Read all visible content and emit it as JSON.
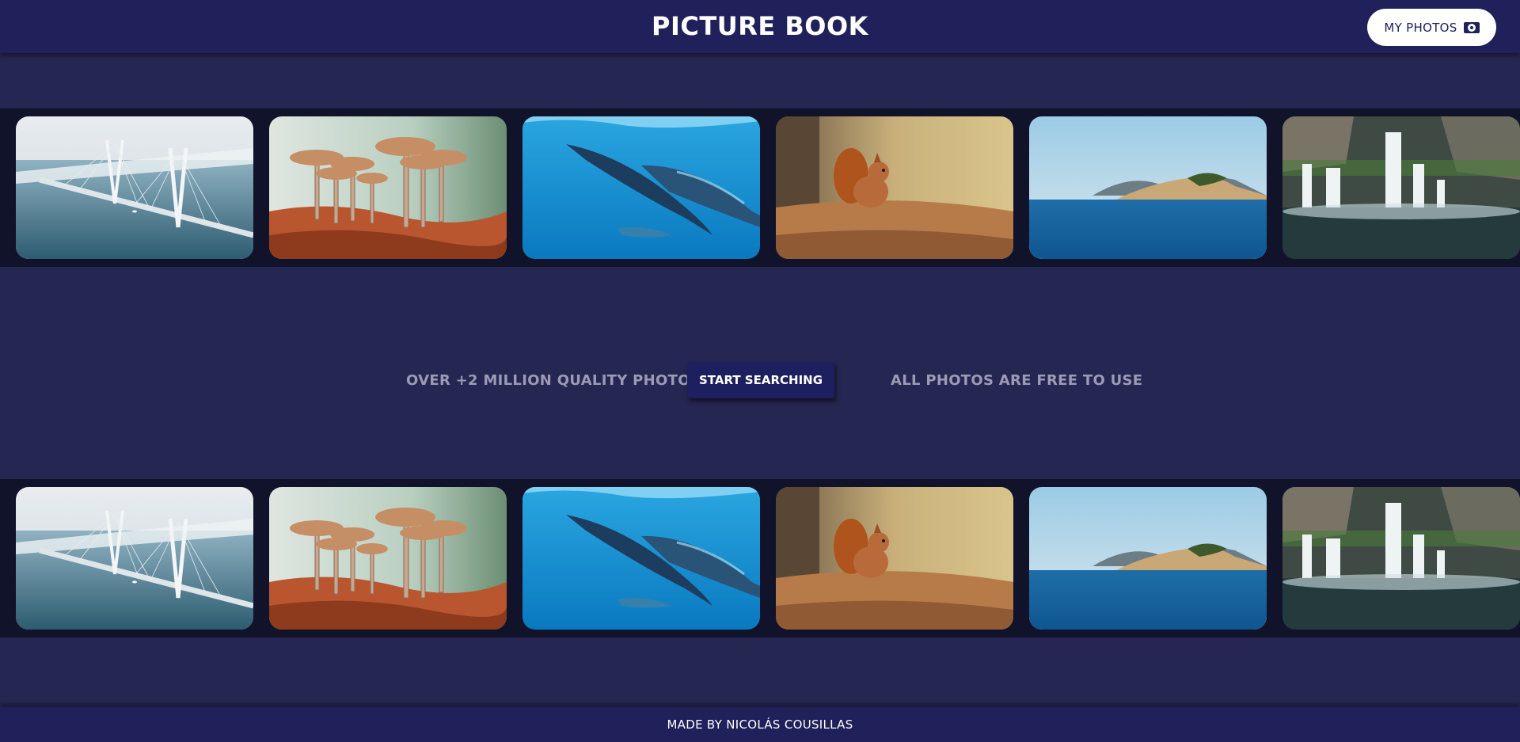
{
  "header": {
    "title": "PICTURE BOOK",
    "my_photos_label": "MY PHOTOS",
    "my_photos_icon": "camera-icon"
  },
  "gallery": {
    "photos": [
      {
        "subject": "cable-stayed bridge over water"
      },
      {
        "subject": "mushrooms"
      },
      {
        "subject": "dolphins underwater"
      },
      {
        "subject": "red squirrel eating"
      },
      {
        "subject": "sea and rocky island"
      },
      {
        "subject": "waterfall"
      }
    ]
  },
  "middle": {
    "left_text": "OVER +2 MILLION QUALITY PHOTOS",
    "button_label": "START SEARCHING",
    "right_text": "ALL PHOTOS ARE FREE TO USE"
  },
  "footer": {
    "credit": "MADE BY NICOLÁS COUSILLAS"
  },
  "colors": {
    "page_background": "#262652",
    "header_background": "#20205a",
    "strip_background": "#11132a",
    "muted_text": "#9b9bb6"
  }
}
